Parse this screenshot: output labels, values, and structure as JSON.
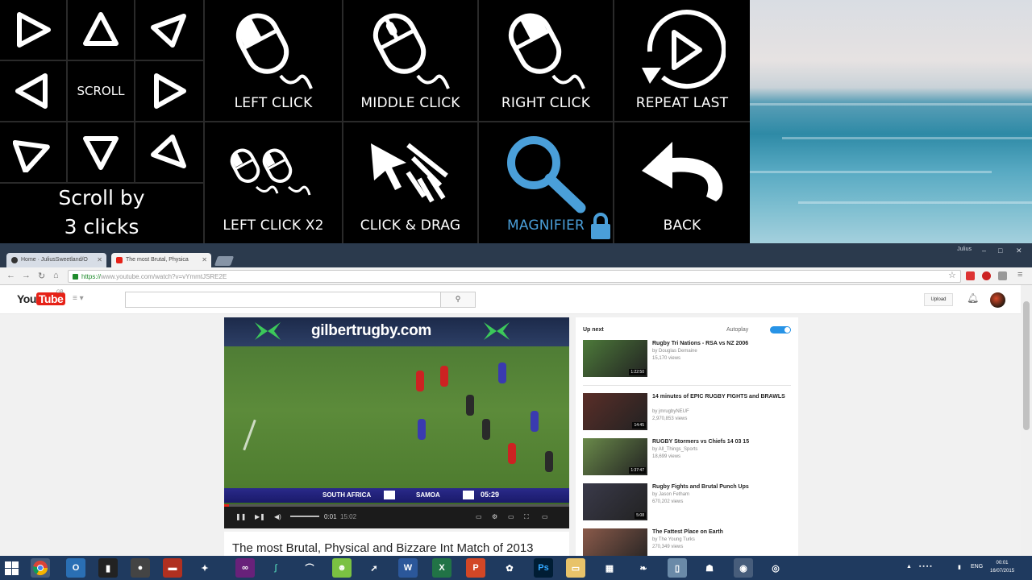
{
  "panel": {
    "scroll_label": "SCROLL",
    "scroll_by": [
      "Scroll by",
      "3 clicks"
    ],
    "commands": {
      "left_click": "LEFT CLICK",
      "middle_click": "MIDDLE CLICK",
      "right_click": "RIGHT CLICK",
      "repeat_last": "REPEAT LAST",
      "left_click_x2": "LEFT CLICK X2",
      "click_drag": "CLICK & DRAG",
      "magnifier": "MAGNIFIER",
      "back": "BACK"
    },
    "colors": {
      "accent": "#4a9fd9",
      "background": "#000000",
      "text": "#ffffff"
    }
  },
  "browser": {
    "user": "Julius",
    "tabs": [
      {
        "label": "Home · JuliusSweetland/O",
        "icon": "github-icon"
      },
      {
        "label": "The most Brutal, Physica",
        "icon": "youtube-icon"
      }
    ],
    "url_scheme": "https://",
    "url_rest": "www.youtube.com/watch?v=vYmmtJSRE2E"
  },
  "youtube": {
    "logo_you": "You",
    "logo_tube": "Tube",
    "logo_region": "GB",
    "upload": "Upload",
    "video": {
      "banner": "gilbertrugby.com",
      "team_home": "SOUTH AFRICA",
      "team_away": "SAMOA",
      "match_clock": "05:29",
      "current_time": "0:01",
      "duration": "15:02",
      "title": "The most Brutal, Physical and Bizzare Int Match of 2013"
    },
    "up_next": "Up next",
    "autoplay": "Autoplay",
    "recommendations": [
      {
        "title": "Rugby Tri Nations - RSA vs NZ 2006",
        "channel": "by Douglas Demaine",
        "views": "15,170 views",
        "duration": "1:22:50",
        "color": "#4d7a3a"
      },
      {
        "title": "14 minutes of EPIC RUGBY FIGHTS and BRAWLS",
        "channel": "by jmrugbyNEUF",
        "views": "2,970,853 views",
        "duration": "14:45",
        "color": "#5a2e28"
      },
      {
        "title": "RUGBY Stormers vs Chiefs 14 03 15",
        "channel": "by All_Things_Sports",
        "views": "18,699 views",
        "duration": "1:37:47",
        "color": "#6a8a4a"
      },
      {
        "title": "Rugby Fights and Brutal Punch Ups",
        "channel": "by Jason Fetham",
        "views": "670,202 views",
        "duration": "5:08",
        "color": "#3a3a4a"
      },
      {
        "title": "The Fattest Place on Earth",
        "channel": "by The Young Turks",
        "views": "270,349 views",
        "duration": "",
        "color": "#8a5a4a"
      }
    ]
  },
  "taskbar": {
    "lang": "ENG",
    "time": "00:01",
    "date": "16/07/2015"
  }
}
